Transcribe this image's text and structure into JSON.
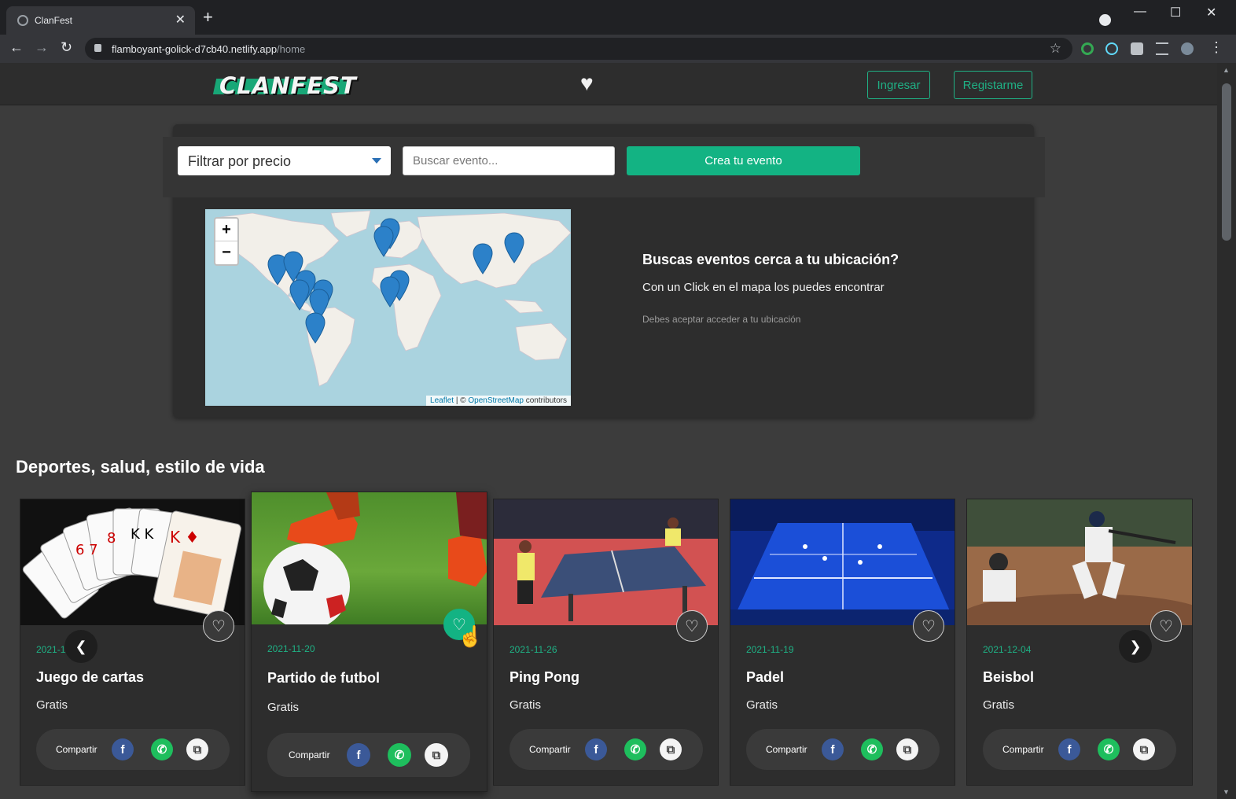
{
  "browser": {
    "tab_title": "ClanFest",
    "url_host": "flamboyant-golick-d7cb40.netlify.app",
    "url_path": "/home"
  },
  "header": {
    "logo_text": "CLANFEST",
    "login_label": "Ingresar",
    "register_label": "Registarme"
  },
  "filters": {
    "price_select": "Filtrar por precio",
    "search_placeholder": "Buscar evento...",
    "create_label": "Crea tu evento"
  },
  "map": {
    "zoom_in": "+",
    "zoom_out": "−",
    "attribution_leaflet": "Leaflet",
    "attribution_sep": " | © ",
    "attribution_osm": "OpenStreetMap",
    "attribution_tail": " contributors"
  },
  "location_info": {
    "title": "Buscas eventos cerca a tu ubicación?",
    "subtitle": "Con un Click en el mapa los puedes encontrar",
    "note": "Debes aceptar acceder a tu ubicación"
  },
  "section": {
    "title": "Deportes, salud, estilo de vida"
  },
  "cards": [
    {
      "date": "2021-11-19",
      "name": "Juego de cartas",
      "price": "Gratis",
      "share": "Compartir",
      "favorited": false
    },
    {
      "date": "2021-11-20",
      "name": "Partido de futbol",
      "price": "Gratis",
      "share": "Compartir",
      "favorited": true
    },
    {
      "date": "2021-11-26",
      "name": "Ping Pong",
      "price": "Gratis",
      "share": "Compartir",
      "favorited": false
    },
    {
      "date": "2021-11-19",
      "name": "Padel",
      "price": "Gratis",
      "share": "Compartir",
      "favorited": false
    },
    {
      "date": "2021-12-04",
      "name": "Beisbol",
      "price": "Gratis",
      "share": "Compartir",
      "favorited": false
    }
  ],
  "colors": {
    "accent": "#13b383",
    "background": "#3c3c3c",
    "panel": "#2d2d2d"
  }
}
